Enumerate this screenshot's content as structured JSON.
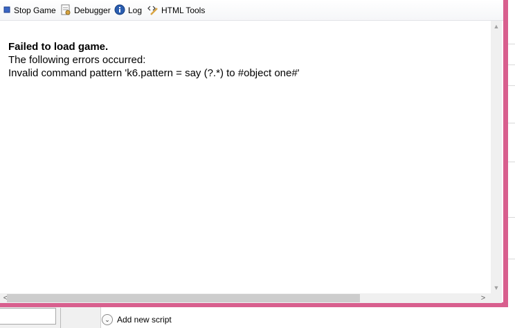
{
  "toolbar": {
    "stop_game_label": "Stop Game",
    "debugger_label": "Debugger",
    "log_label": "Log",
    "html_tools_label": "HTML Tools"
  },
  "output": {
    "title": "Failed to load game.",
    "subtitle": "The following errors occurred:",
    "detail": "Invalid command pattern 'k6.pattern = say (?.*) to #object one#'"
  },
  "scrollbars": {
    "up_arrow": "▲",
    "down_arrow": "▼",
    "left_arrow": "<",
    "right_arrow": ">"
  },
  "script_editor": {
    "add_new_script_label": "Add new script",
    "add_icon_glyph": "⌄"
  },
  "colors": {
    "window_border": "#d85f8e",
    "stop_icon": "#3a66c4",
    "info_icon": "#2a5db0"
  }
}
